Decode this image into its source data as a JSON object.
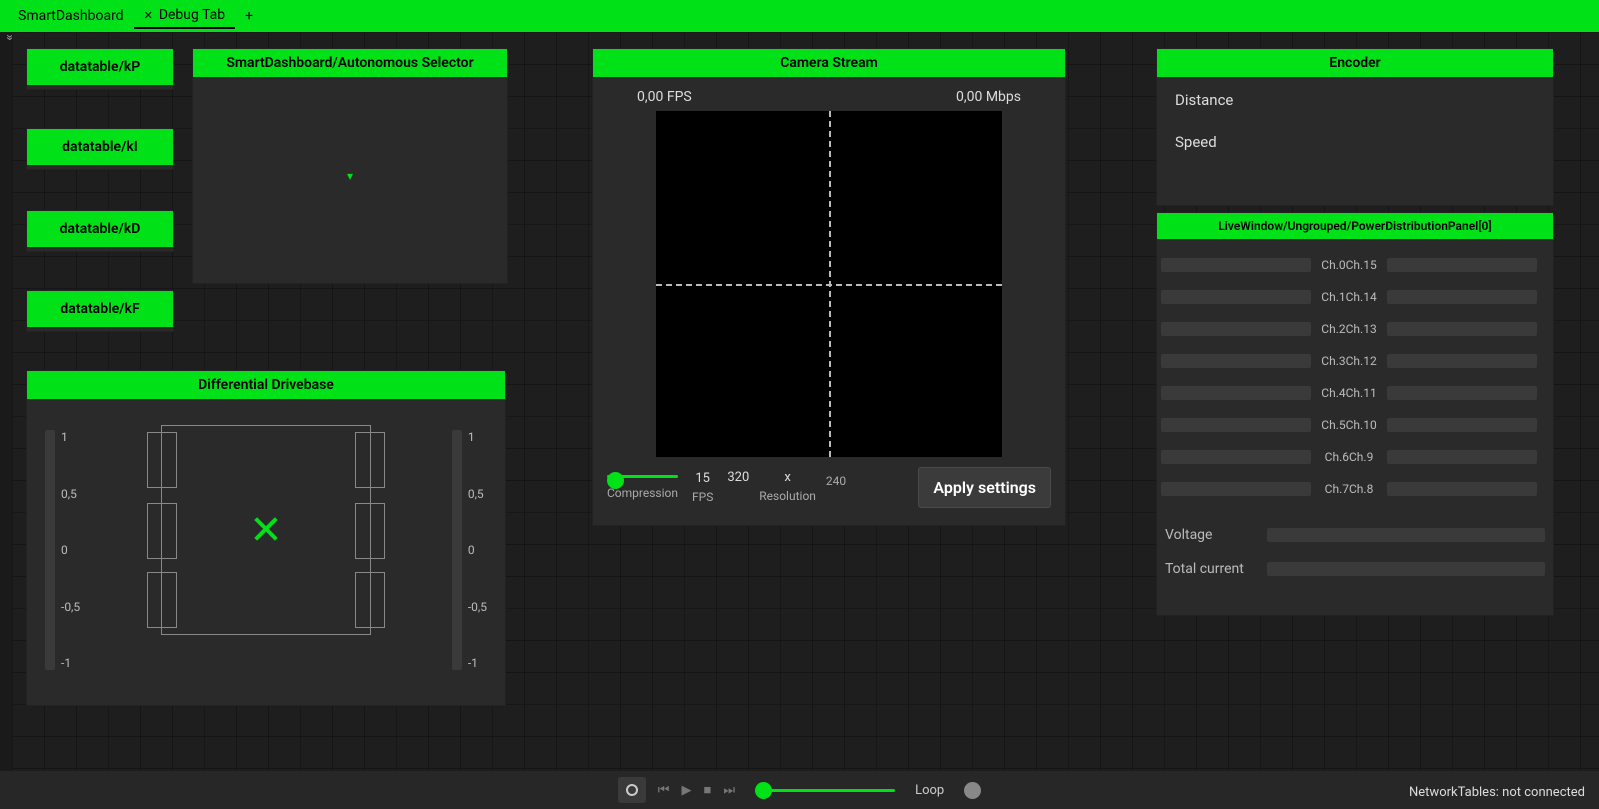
{
  "tabs": [
    {
      "label": "SmartDashboard",
      "active": false,
      "closable": false
    },
    {
      "label": "Debug Tab",
      "active": true,
      "closable": true
    }
  ],
  "add_tab_glyph": "+",
  "pid_tiles": [
    {
      "title": "datatable/kP"
    },
    {
      "title": "datatable/kI"
    },
    {
      "title": "datatable/kD"
    },
    {
      "title": "datatable/kF"
    }
  ],
  "selector": {
    "title": "SmartDashboard/Autonomous Selector"
  },
  "camera": {
    "title": "Camera Stream",
    "fps_readout": "0,00 FPS",
    "mbps_readout": "0,00 Mbps",
    "compression_label": "Compression",
    "fps_val": "15",
    "fps_label": "FPS",
    "res_w": "320",
    "res_x": "x",
    "res_h": "240",
    "res_label": "Resolution",
    "apply_label": "Apply settings"
  },
  "drive": {
    "title": "Differential Drivebase",
    "ticks": [
      "1",
      "0,5",
      "0",
      "-0,5",
      "-1"
    ]
  },
  "encoder": {
    "title": "Encoder",
    "rows": [
      "Distance",
      "Speed"
    ]
  },
  "pdp": {
    "title": "LiveWindow/Ungrouped/PowerDistributionPanel[0]",
    "channels": [
      {
        "l": "Ch.0",
        "r": "Ch.15"
      },
      {
        "l": "Ch.1",
        "r": "Ch.14"
      },
      {
        "l": "Ch.2",
        "r": "Ch.13"
      },
      {
        "l": "Ch.3",
        "r": "Ch.12"
      },
      {
        "l": "Ch.4",
        "r": "Ch.11"
      },
      {
        "l": "Ch.5",
        "r": "Ch.10"
      },
      {
        "l": "Ch.6",
        "r": "Ch.9"
      },
      {
        "l": "Ch.7",
        "r": "Ch.8"
      }
    ],
    "voltage_label": "Voltage",
    "current_label": "Total current"
  },
  "playback": {
    "loop_label": "Loop"
  },
  "status": "NetworkTables: not connected"
}
